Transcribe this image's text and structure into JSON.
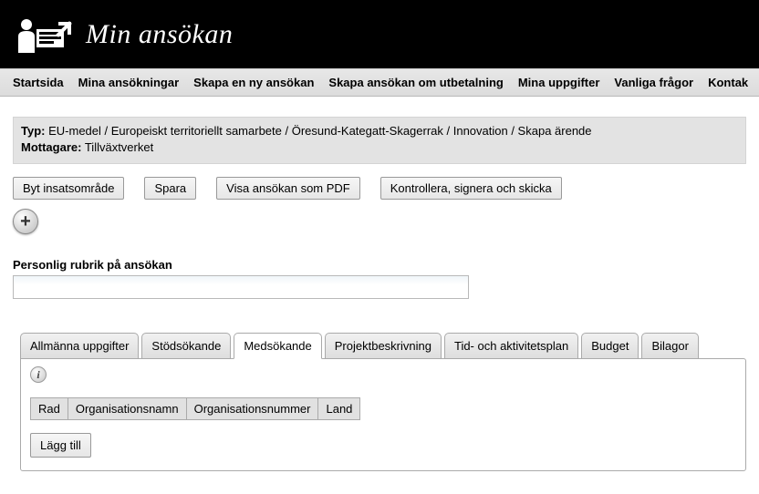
{
  "header": {
    "site_title": "Min ansökan"
  },
  "nav": {
    "items": [
      "Startsida",
      "Mina ansökningar",
      "Skapa en ny ansökan",
      "Skapa ansökan om utbetalning",
      "Mina uppgifter",
      "Vanliga frågor",
      "Kontak"
    ]
  },
  "infobox": {
    "typ_label": "Typ:",
    "typ_value": "EU-medel / Europeiskt territoriellt samarbete / Öresund-Kategatt-Skagerrak / Innovation / Skapa ärende",
    "mottagare_label": "Mottagare:",
    "mottagare_value": "Tillväxtverket"
  },
  "actions": {
    "byt": "Byt insatsområde",
    "spara": "Spara",
    "visa_pdf": "Visa ansökan som PDF",
    "kontrollera": "Kontrollera, signera och skicka"
  },
  "personal_heading_label": "Personlig rubrik på ansökan",
  "personal_heading_value": "",
  "tabs": {
    "items": [
      "Allmänna uppgifter",
      "Stödsökande",
      "Medsökande",
      "Projektbeskrivning",
      "Tid- och aktivitetsplan",
      "Budget",
      "Bilagor"
    ],
    "active_index": 2
  },
  "table": {
    "headers": [
      "Rad",
      "Organisationsnamn",
      "Organisationsnummer",
      "Land"
    ]
  },
  "add_button": "Lägg till"
}
